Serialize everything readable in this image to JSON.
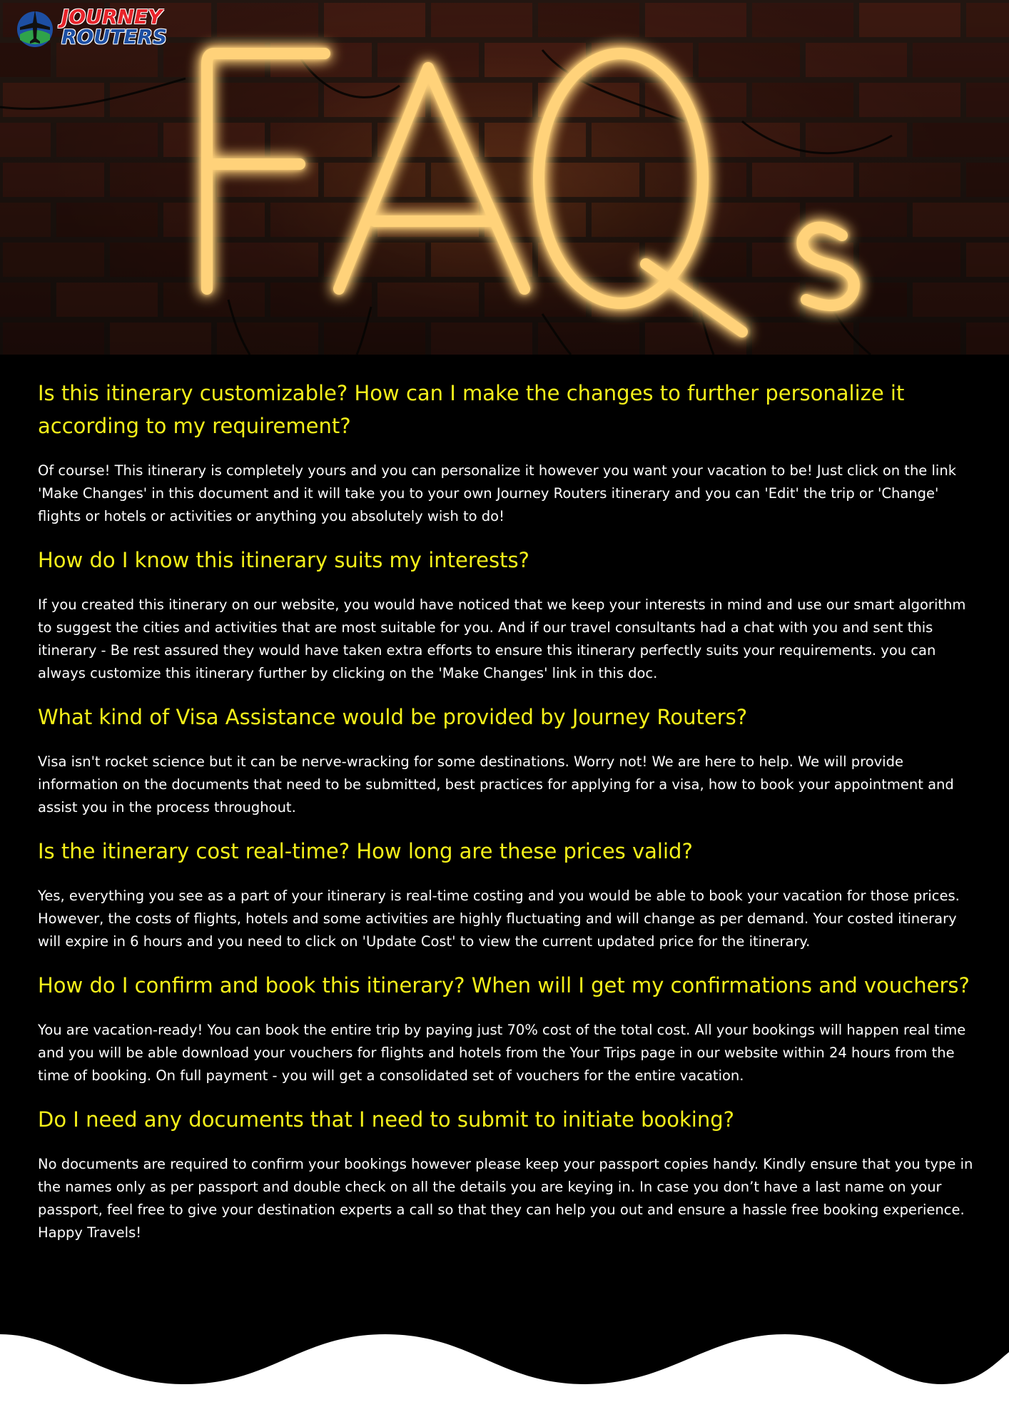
{
  "brand": {
    "name_line1": "JOURNEY",
    "name_line2": "ROUTERS",
    "red": "#e8242b",
    "blue": "#1d4fa3"
  },
  "hero": {
    "neon_text": "FAQs",
    "neon_color": "#ffd27a",
    "glow_color": "#ff9a1f"
  },
  "colors": {
    "question": "#f5f01a",
    "answer": "#ffffff",
    "background": "#000000"
  },
  "faqs": [
    {
      "question": "Is this itinerary customizable? How can I make the changes to further personalize it according to my requirement?",
      "answer": "Of course! This itinerary is completely yours and you can personalize it however you want your vacation to be! Just click on the link 'Make Changes' in this document and it will take you to your own Journey Routers itinerary and you can 'Edit' the trip or 'Change' flights or hotels or activities or anything you absolutely wish to do!"
    },
    {
      "question": "How do I know this itinerary suits my interests?",
      "answer": "If you created this itinerary on our website, you would have noticed that we keep your interests in mind and use our smart algorithm to suggest the cities and activities that are most suitable for you. And if our travel consultants had a chat with you and sent this itinerary - Be rest assured they would have taken extra efforts to ensure this itinerary perfectly suits your requirements. you can always customize this itinerary further by clicking on the 'Make Changes' link in this doc."
    },
    {
      "question": "What kind of Visa Assistance would be provided by Journey Routers?",
      "answer": "Visa isn't rocket science but it can be nerve-wracking for some destinations. Worry not! We are here to help. We will provide information on the documents that need to be submitted, best practices for applying for a visa, how to book your appointment and assist you in the process throughout."
    },
    {
      "question": "Is the itinerary cost real-time? How long are these prices valid?",
      "answer": "Yes, everything you see as a part of your itinerary is real-time costing and you would be able to book your vacation for those prices. However, the costs of flights, hotels and some activities are highly fluctuating and will change as per demand. Your costed itinerary will expire in 6 hours and you need to click on 'Update Cost' to view the current updated price for the itinerary."
    },
    {
      "question": "How do I confirm and book this itinerary? When will I get my confirmations and vouchers?",
      "answer": "You are vacation-ready! You can book the entire trip by paying just 70% cost of the total cost. All your bookings will happen real time and you will be able download your vouchers for flights and hotels from the Your Trips page in our website within 24 hours from the time of booking. On full payment - you will get a consolidated set of vouchers for the entire vacation."
    },
    {
      "question": "Do I need any documents that I need to submit to initiate booking?",
      "answer": "No documents are required to confirm your bookings however please keep your passport copies handy. Kindly ensure that you type in the names only as per passport and double check on all the details you are keying in. In case you don’t have a last name on your passport, feel free to give your destination experts a call so that they can help you out and ensure a hassle free booking experience. Happy Travels!"
    }
  ]
}
